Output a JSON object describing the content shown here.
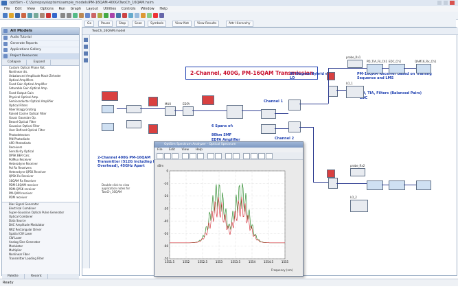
{
  "window": {
    "title": "optiSim - C:\\Synopsys\\optsim\\sample_models\\PM-16QAM-400G\\TwoCh_16QAM.hsim"
  },
  "menu": [
    "File",
    "Edit",
    "View",
    "Options",
    "Run",
    "Graph",
    "Layout",
    "Utilities",
    "Controls",
    "Window",
    "Help"
  ],
  "canvas_toolbar": {
    "go": "Go",
    "pause": "Pause",
    "stop": "Stop",
    "scan": "Scan",
    "symbols": "Symbols",
    "view_net": "View Net",
    "view_results": "View Results",
    "attr_hierarchy": "Attr Hierarchy"
  },
  "canvas_tab": "TwoCh_16QAM.model",
  "left_panel": {
    "header": "All Models",
    "rows": [
      "Audio Tutorial",
      "Generate Reports",
      "Applications Gallery",
      "Project Resources"
    ],
    "subtabs": [
      "Collapse",
      "Expand"
    ],
    "tree": [
      "Custom Optical Phase Rot.",
      "Nonlinear dis.",
      "Unbalanced Amplitude Mach-Zehnder",
      "Optical Amplifiers",
      "Fixed Gain Optical Amplifier",
      "Saturable Gain Optical Amp.",
      "Fixed Output Gain",
      "Physical Optical Amp.",
      "Semiconductor Optical Amplifier",
      "Optical Filters",
      "Fiber Bragg Grating",
      "Raised Cosine Optical Filter",
      "Gauss Gaussian Op.",
      "Bessel Optical Filter",
      "Gaussian Optical Filter",
      "User Defined Optical Filter",
      "Photodetectors",
      "PIN Photodiode",
      "APD Photodiode",
      "Receivers",
      "Sensitivity Optical",
      "DPSK BER Calc.",
      "PolMux Receiver",
      "Heterodyne Receiver",
      "Pol Rx Receivers",
      "Heterodyne QPSK Receiver",
      "QPSK Rx Receiver",
      "16QAM Rx Receiver",
      "PDM-16QAM receiver",
      "PDM-QPSK receiver",
      "PM-QAM receiver",
      "PDM receiver"
    ],
    "lower_list": [
      "Bias Signal Generator",
      "Electrical Combiner",
      "Super-Gaussian Optical Pulse Generator",
      "Optical Combiner",
      "Data Source",
      "DAC Amplitude Modulator",
      "NRZ Rectangular Driver",
      "Spatial CW Laser",
      "CW Laser",
      "Analog Sine Generator",
      "Modulator",
      "Multiplier",
      "Nonlinear Fiber",
      "Transmitter Loading Filter"
    ],
    "bottom_tabs": [
      "Palette",
      "Recent"
    ]
  },
  "diagram": {
    "title": "2-Channel, 400G, PM-16QAM Transmission",
    "hybrid": "90-Degree Hybrid with LO",
    "receiver_desc": "PM-16QAM Receiver based on Training Sequence and LMS",
    "receiver_bullets": [
      "- PD, TIA, Filters (Balanced Pairs)",
      "- EDC"
    ],
    "spans": "6 Spans of:",
    "smf": "80km SMF",
    "edfa_span": "EDFA Amplifier",
    "channel1": "Channel 1",
    "channel2": "Channel 2",
    "tx_desc": "2-Channel 400G PM-16QAM Transmitter (512G including FEC Overhead), 45GHz Apart",
    "dbl_click": "Double-click to view application notes for TwoCh_16QAM",
    "labels": {
      "mux": "MUX",
      "edfa": "EDFA",
      "flags": "flags_Ch1",
      "ch1": "Ch1",
      "sq": "SuperSq",
      "probe1": "probe_Rx1",
      "probe2": "probe_Rx2",
      "lo1": "LO_1",
      "lo2": "LO_2",
      "pdtia": "PD_TIA_Fil_Ch1",
      "edc": "EDC_Ch1",
      "qamrx": "QAM16_Rx_Ch1"
    }
  },
  "plot_window": {
    "title": "OptSim Spectrum Analyzer - Optical Spectrum",
    "menu": [
      "File",
      "Edit",
      "View",
      "Help"
    ],
    "y_ticks": [
      "0",
      "-10",
      "-20",
      "-30",
      "-40",
      "-50",
      "-60",
      "-70"
    ],
    "x_ticks": [
      "1551.5",
      "1552",
      "1552.5",
      "1553",
      "1553.5",
      "1554",
      "1554.5",
      "1555"
    ],
    "x_label": "Frequency (nm)",
    "y_label": "dBm"
  },
  "status": "Ready"
}
